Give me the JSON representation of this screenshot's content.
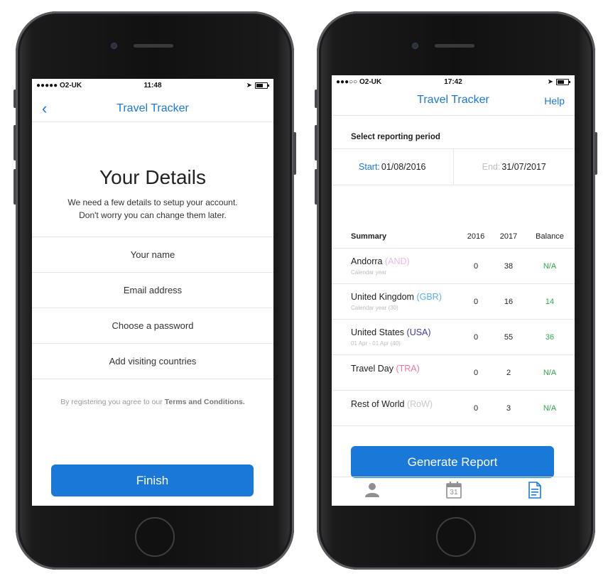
{
  "left_screen": {
    "status": {
      "carrier": "●●●●● O2-UK",
      "time": "11:48"
    },
    "nav": {
      "title": "Travel Tracker"
    },
    "heading": "Your Details",
    "subtitle_line1": "We need a few details to setup your account.",
    "subtitle_line2": "Don't worry you can change them later.",
    "fields": [
      {
        "placeholder": "Your name"
      },
      {
        "placeholder": "Email address"
      },
      {
        "placeholder": "Choose a password"
      },
      {
        "placeholder": "Add visiting countries"
      }
    ],
    "terms_prefix": "By registering you agree to our",
    "terms_link": "Terms and Conditions.",
    "finish_label": "Finish"
  },
  "right_screen": {
    "status": {
      "carrier": "●●●○○ O2-UK",
      "time": "17:42"
    },
    "nav": {
      "title": "Travel Tracker",
      "help": "Help"
    },
    "reporting_label": "Select reporting period",
    "start_label": "Start:",
    "start_value": "01/08/2016",
    "end_label": "End:",
    "end_value": "31/07/2017",
    "summary": {
      "headers": [
        "Summary",
        "2016",
        "2017",
        "Balance"
      ],
      "rows": [
        {
          "name": "Andorra",
          "code": "(AND)",
          "note": "Calendar year",
          "y2016": "0",
          "y2017": "38",
          "balance": "N/A"
        },
        {
          "name": "United Kingdom",
          "code": "(GBR)",
          "note": "Calendar year (30)",
          "y2016": "0",
          "y2017": "16",
          "balance": "14"
        },
        {
          "name": "United States",
          "code": "(USA)",
          "note": "01 Apr - 01 Apr (40)",
          "y2016": "0",
          "y2017": "55",
          "balance": "36"
        },
        {
          "name": "Travel Day",
          "code": "(TRA)",
          "note": "",
          "y2016": "0",
          "y2017": "2",
          "balance": "N/A"
        },
        {
          "name": "Rest of World",
          "code": "(RoW)",
          "note": "",
          "y2016": "0",
          "y2017": "3",
          "balance": "N/A"
        }
      ]
    },
    "generate_label": "Generate Report",
    "calendar_day": "31",
    "colors": {
      "accent": "#1a78d8",
      "andorra_code": "#e8b8e6",
      "gbr_code": "#5aaee8",
      "usa_code": "#3a3aa8",
      "tra_code": "#e87aa4",
      "row_code": "#c8c8c8",
      "balance_green": "#2da84b"
    },
    "icons": [
      "person-icon",
      "calendar-icon",
      "report-icon"
    ]
  }
}
